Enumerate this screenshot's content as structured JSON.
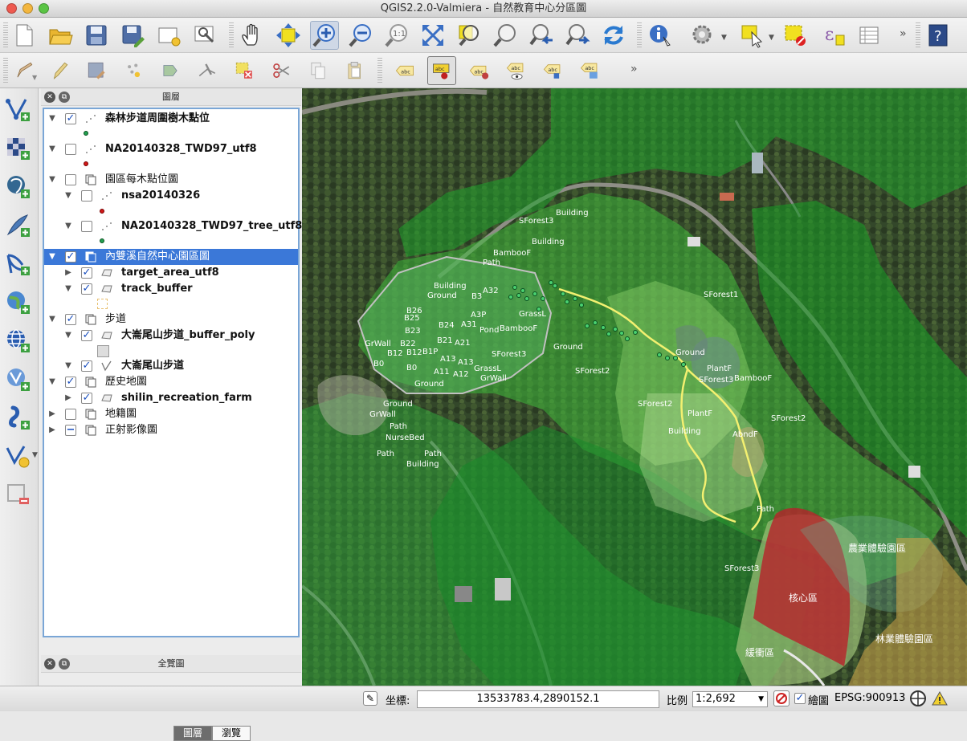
{
  "window": {
    "title": "QGIS2.2.0-Valmiera - 自然教育中心分區圖"
  },
  "toolbar1": {
    "icons": [
      "new-project-icon",
      "open-project-icon",
      "save-project-icon",
      "save-as-icon",
      "new-print-composer-icon",
      "composer-manager-icon",
      "pan-icon",
      "pan-to-selection-icon",
      "zoom-in-icon",
      "zoom-out-icon",
      "zoom-actual-size-icon",
      "zoom-full-icon",
      "zoom-to-selection-icon",
      "zoom-to-layer-icon",
      "zoom-last-icon",
      "zoom-next-icon",
      "refresh-icon",
      "identify-icon",
      "run-action-icon",
      "select-features-icon",
      "deselect-icon",
      "measure-icon",
      "attribute-table-icon",
      "help-icon"
    ]
  },
  "toolbar2": {
    "icons": [
      "current-edits-icon",
      "toggle-editing-icon",
      "save-edits-icon",
      "add-feature-icon",
      "move-feature-icon",
      "node-tool-icon",
      "delete-selected-icon",
      "cut-features-icon",
      "copy-features-icon",
      "paste-features-icon",
      "label-icon",
      "pin-labels-icon",
      "highlight-pinned-icon",
      "move-label-icon",
      "rotate-label-icon",
      "change-label-icon"
    ],
    "label_text": "abc"
  },
  "left_toolbar": {
    "icons": [
      "add-vector-layer-icon",
      "add-raster-layer-icon",
      "add-postgis-layer-icon",
      "add-spatialite-layer-icon",
      "add-mssql-layer-icon",
      "add-wms-layer-icon",
      "add-wcs-layer-icon",
      "add-wfs-layer-icon",
      "add-delimited-text-icon",
      "new-shapefile-icon",
      "remove-layer-icon"
    ]
  },
  "layers_panel": {
    "title": "圖層",
    "layers": [
      {
        "name": "森林步道周圍樹木點位",
        "checked": true,
        "symbol_color": "#22a050"
      },
      {
        "name": "NA20140328_TWD97_utf8",
        "checked": false,
        "symbol_color": "#d01818"
      },
      {
        "name": "園區每木點位圖",
        "checked": false
      },
      {
        "name": "nsa20140326",
        "checked": false,
        "symbol_color": "#d01818"
      },
      {
        "name": "NA20140328_TWD97_tree_utf8",
        "checked": false,
        "symbol_color": "#22a050"
      },
      {
        "name": "內雙溪自然中心園區圖",
        "checked": true,
        "selected": true
      },
      {
        "name": "target_area_utf8",
        "checked": true
      },
      {
        "name": "track_buffer",
        "checked": true
      },
      {
        "name": "步道",
        "checked": true
      },
      {
        "name": "大崙尾山步道_buffer_poly",
        "checked": true
      },
      {
        "name": "大崙尾山步道",
        "checked": true
      },
      {
        "name": "歷史地圖",
        "checked": true
      },
      {
        "name": "shilin_recreation_farm",
        "checked": true
      },
      {
        "name": "地籍圖",
        "checked": false
      },
      {
        "name": "正射影像圖",
        "checked": "partial",
        "check_mark": "−"
      }
    ],
    "check_mark": "✓",
    "tabs": [
      "圖層",
      "瀏覽"
    ]
  },
  "overview_panel": {
    "title": "全覽圖"
  },
  "map": {
    "labels": [
      "SForest3",
      "Building",
      "Building",
      "BambooF",
      "Path",
      "Building",
      "Ground",
      "A32",
      "B26",
      "B3",
      "A3P",
      "B25",
      "B24",
      "A31",
      "Pond",
      "BambooF",
      "GrassL",
      "B23",
      "GrWall",
      "B22",
      "B21",
      "A21",
      "B12",
      "B12",
      "B1P",
      "A13",
      "A13",
      "SForest3",
      "B0",
      "B0",
      "A11",
      "A12",
      "GrassL",
      "GrWall",
      "Ground",
      "Ground",
      "SForest2",
      "Ground",
      "PlantF",
      "SForest3",
      "BambooF",
      "SForest1",
      "SForest2",
      "SForest2",
      "PlantF",
      "Building",
      "AbndF",
      "Ground",
      "GrWall",
      "Path",
      "NurseBed",
      "Path",
      "Path",
      "Building",
      "Path",
      "SForest3",
      "農業體驗園區",
      "核心區",
      "緩衝區",
      "林業體驗園區"
    ]
  },
  "status_bar": {
    "coord_label": "坐標:",
    "coord_value": "13533783.4,2890152.1",
    "scale_label": "比例",
    "scale_value": "1:2,692",
    "render_label": "繪圖",
    "render_checked": true,
    "crs": "EPSG:900913"
  }
}
